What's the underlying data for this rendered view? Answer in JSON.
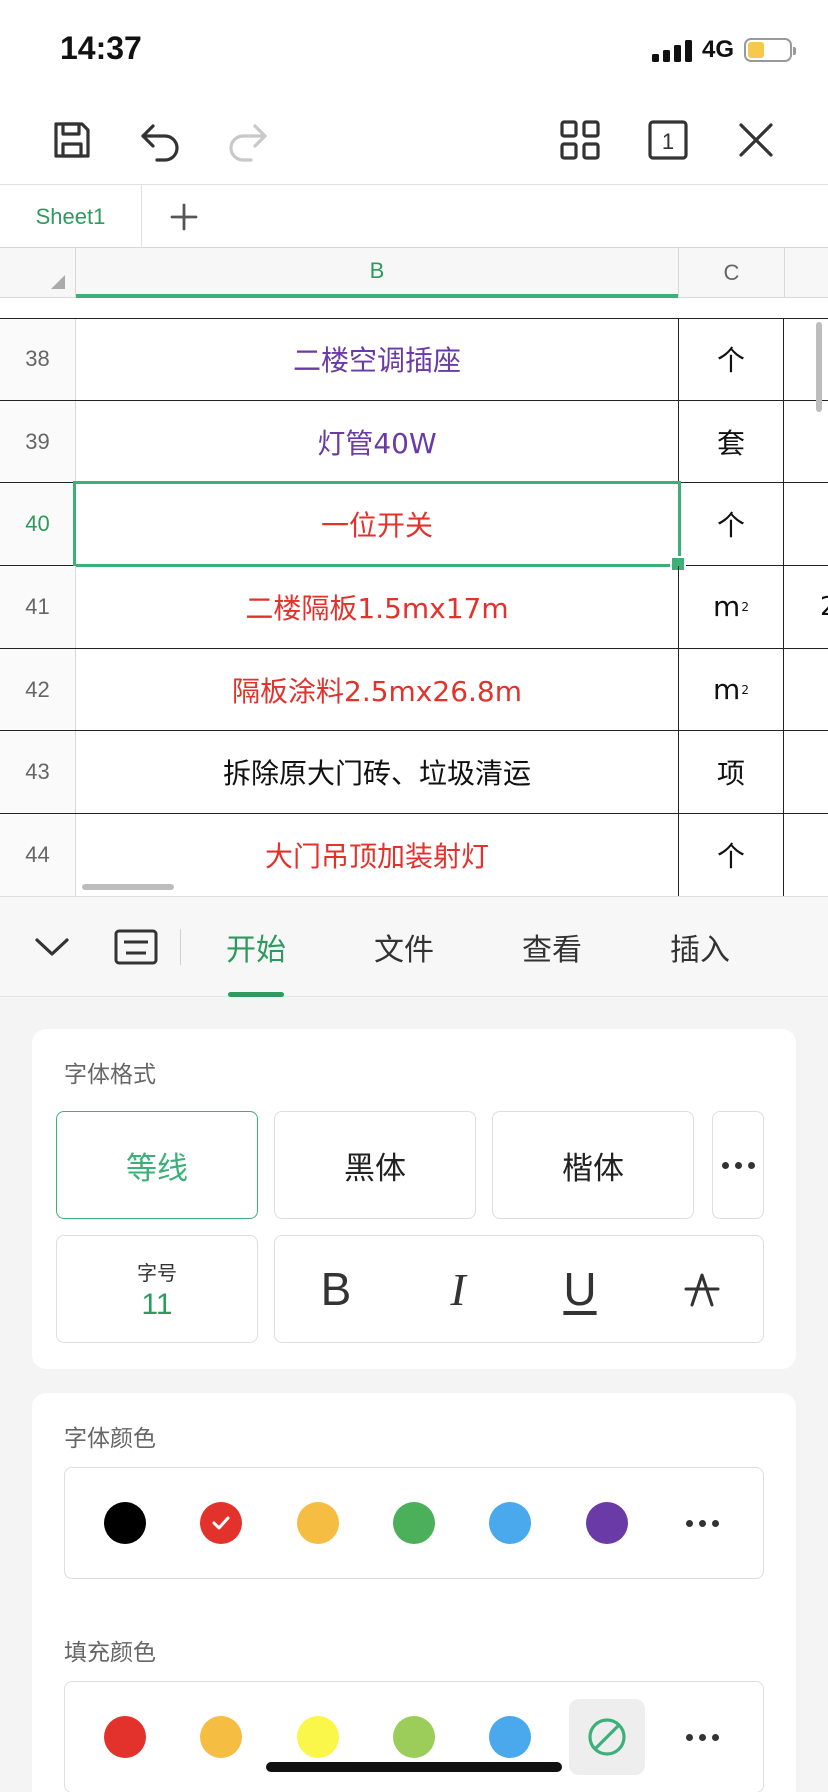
{
  "status": {
    "time": "14:37",
    "network": "4G",
    "battery_level": 0.4
  },
  "toolbar": {
    "icons": [
      "save-icon",
      "undo-icon",
      "redo-icon",
      "grid-view-icon",
      "sheet-count-icon",
      "close-icon"
    ],
    "sheet_count": "1"
  },
  "sheets": {
    "tabs": [
      {
        "label": "Sheet1"
      }
    ],
    "add_icon": "plus-icon"
  },
  "grid": {
    "columns": [
      "B",
      "C"
    ],
    "selected_row": "40",
    "rows": [
      {
        "num": "38",
        "b": "二楼空调插座",
        "c": "个",
        "d": "",
        "color": "#6a3aa6"
      },
      {
        "num": "39",
        "b": "灯管40W",
        "c": "套",
        "d": "",
        "color": "#6a3aa6"
      },
      {
        "num": "40",
        "b": "一位开关",
        "c": "个",
        "d": "",
        "color": "#e3322c"
      },
      {
        "num": "41",
        "b": "二楼隔板1.5mx17m",
        "c": "m",
        "c_sup": "2",
        "d": "2",
        "color": "#e3322c"
      },
      {
        "num": "42",
        "b": "隔板涂料2.5mx26.8m",
        "c": "m",
        "c_sup": "2",
        "d": "",
        "color": "#e3322c"
      },
      {
        "num": "43",
        "b": "拆除原大门砖、垃圾清运",
        "c": "项",
        "d": "",
        "color": "#111111"
      },
      {
        "num": "44",
        "b": "大门吊顶加装射灯",
        "c": "个",
        "d": "",
        "color": "#e3322c"
      }
    ]
  },
  "panel": {
    "tabs": [
      {
        "label": "开始",
        "active": true
      },
      {
        "label": "文件",
        "active": false
      },
      {
        "label": "查看",
        "active": false
      },
      {
        "label": "插入",
        "active": false
      }
    ],
    "font_format": {
      "title": "字体格式",
      "fonts": [
        {
          "label": "等线",
          "active": true
        },
        {
          "label": "黑体",
          "active": false
        },
        {
          "label": "楷体",
          "active": false
        }
      ],
      "size_label": "字号",
      "size_value": "11",
      "styles": [
        {
          "label": "B",
          "name": "bold-button"
        },
        {
          "label": "I",
          "name": "italic-button"
        },
        {
          "label": "U",
          "name": "underline-button"
        }
      ]
    },
    "font_color": {
      "title": "字体颜色",
      "colors": [
        "#000000",
        "#e3322c",
        "#f5bd41",
        "#4caf5a",
        "#4aa8ec",
        "#6a3aa6"
      ],
      "selected_index": 1
    },
    "fill_color": {
      "title": "填充颜色",
      "colors": [
        "#e3322c",
        "#f5bd41",
        "#fbf64a",
        "#9ccc5a",
        "#4aa8ec"
      ]
    }
  }
}
